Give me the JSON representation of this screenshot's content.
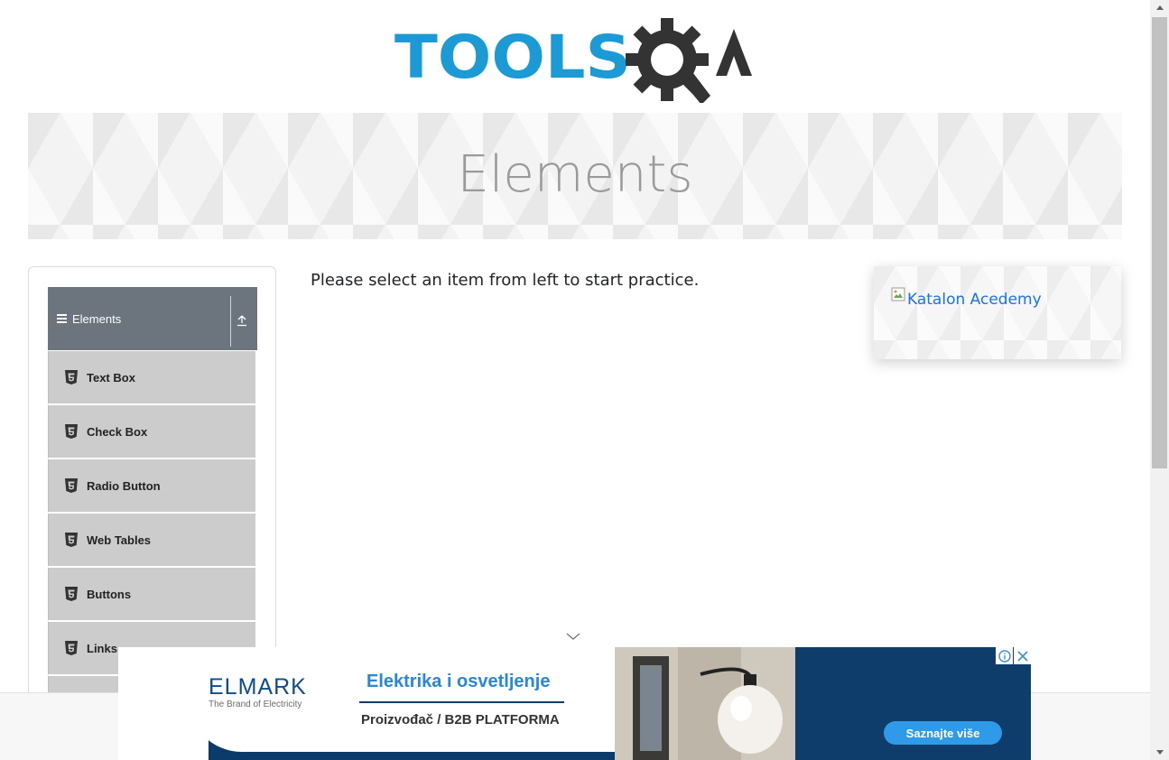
{
  "header": {
    "logo_text": "TOOLSQA"
  },
  "banner": {
    "title": "Elements"
  },
  "sidebar": {
    "group_title": "Elements",
    "items": [
      {
        "label": "Text Box"
      },
      {
        "label": "Check Box"
      },
      {
        "label": "Radio Button"
      },
      {
        "label": "Web Tables"
      },
      {
        "label": "Buttons"
      },
      {
        "label": "Links"
      },
      {
        "label": ""
      }
    ]
  },
  "main": {
    "instruction": "Please select an item from left to start practice."
  },
  "side_ad": {
    "alt_text": "Katalon Acedemy"
  },
  "bottom_ad": {
    "brand": "ELMARK",
    "tagline": "The Brand of Electricity",
    "headline": "Elektrika i osvetljenje",
    "subline": "Proizvođač / B2B PLATFORMA",
    "cta": "Saznajte više",
    "info_icon": "info-icon",
    "close_icon": "close-icon"
  },
  "colors": {
    "logo_blue": "#1b9ad6",
    "logo_dark": "#333333",
    "group_header": "#6c757d",
    "menu_item": "#cccccc",
    "link": "#1a73e8",
    "ad_blue": "#0b3b6b",
    "cta_blue": "#2f9ae8"
  }
}
